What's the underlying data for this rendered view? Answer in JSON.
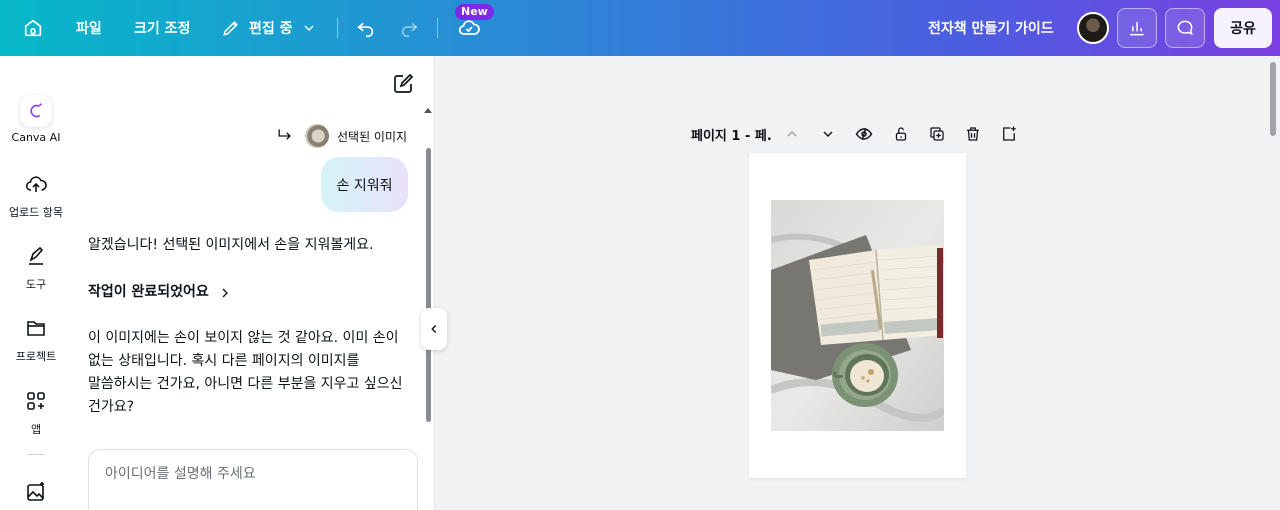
{
  "topbar": {
    "file_label": "파일",
    "resize_label": "크기 조정",
    "editing_label": "편집 중",
    "new_badge": "New",
    "doc_title": "전자책 만들기 가이드",
    "share_label": "공유"
  },
  "rail": {
    "items": [
      {
        "label": "Canva AI",
        "icon": "canva-ai-icon"
      },
      {
        "label": "업로드 항목",
        "icon": "cloud-upload-icon"
      },
      {
        "label": "도구",
        "icon": "pen-tool-icon"
      },
      {
        "label": "프로젝트",
        "icon": "folder-icon"
      },
      {
        "label": "앱",
        "icon": "apps-icon"
      }
    ]
  },
  "chat": {
    "reference_label": "선택된 이미지",
    "user_message": "손 지워줘",
    "reply_1": "알겠습니다! 선택된 이미지에서 손을 지워볼게요.",
    "task_done": "작업이 완료되었어요",
    "reply_2_lines": [
      "이 이미지에는 손이 보이지 않는 것 같아요. 이미 손이",
      "없는 상태입니다. 혹시 다른 페이지의 이미지를",
      "말씀하시는 건가요, 아니면 다른 부분을 지우고 싶으신",
      "건가요?"
    ],
    "input_placeholder": "아이디어를 설명해 주세요"
  },
  "canvas": {
    "page_label": "페이지 1 - 페."
  },
  "colors": {
    "gradient_start": "#06b8c8",
    "gradient_end": "#7a3fe0",
    "badge": "#7c2ae8",
    "canva_ai_accent": "#8b3dff"
  }
}
